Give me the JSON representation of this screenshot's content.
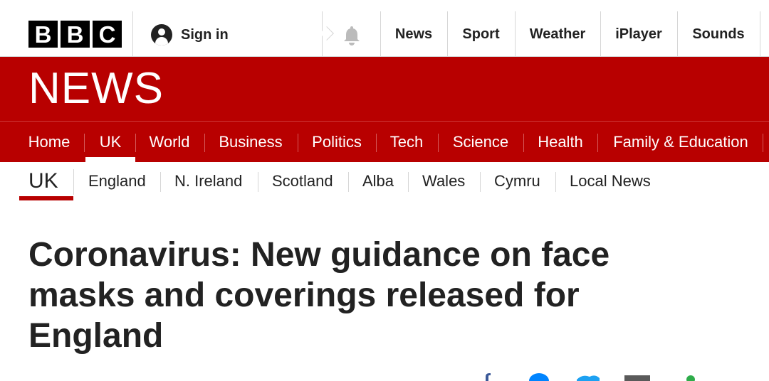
{
  "brand": {
    "logo_letters": [
      "B",
      "B",
      "C"
    ],
    "wordmark": "NEWS",
    "color": "#b80000"
  },
  "topbar": {
    "signin_label": "Sign in",
    "signin_icon": "user-icon",
    "notification_icon": "bell-icon",
    "nav": [
      "News",
      "Sport",
      "Weather",
      "iPlayer",
      "Sounds"
    ]
  },
  "main_nav": {
    "items": [
      "Home",
      "UK",
      "World",
      "Business",
      "Politics",
      "Tech",
      "Science",
      "Health",
      "Family & Education"
    ],
    "active": "UK"
  },
  "sub_nav": {
    "title": "UK",
    "items": [
      "England",
      "N. Ireland",
      "Scotland",
      "Alba",
      "Wales",
      "Cymru",
      "Local News"
    ]
  },
  "article": {
    "headline": "Coronavirus: New guidance on face masks and coverings released for England"
  },
  "share": {
    "icons": [
      "facebook-icon",
      "messenger-icon",
      "twitter-icon",
      "email-icon",
      "share-icon"
    ]
  }
}
